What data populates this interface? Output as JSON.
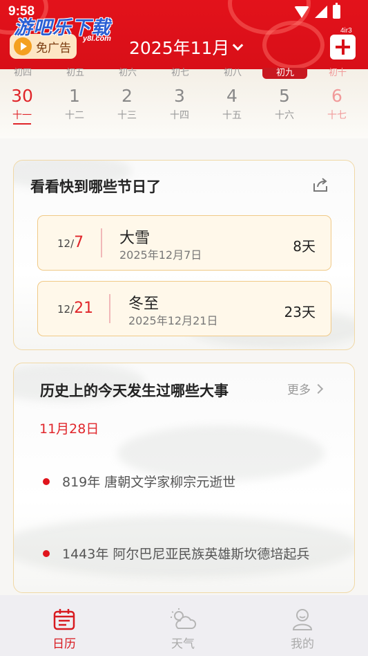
{
  "status_bar": {
    "time": "9:58"
  },
  "watermark": {
    "text": "游吧乐下载",
    "sub": "y8l.com"
  },
  "header": {
    "ad_free_label": "免广告",
    "month_label": "2025年11月",
    "badge_text": "4ir3"
  },
  "week": {
    "partial_labels": [
      "初四",
      "初五",
      "初六",
      "初七",
      "初八",
      "初九",
      "初十"
    ],
    "days": [
      {
        "num": "30",
        "lunar": "十一",
        "state": "today"
      },
      {
        "num": "1",
        "lunar": "十二",
        "state": "normal"
      },
      {
        "num": "2",
        "lunar": "十三",
        "state": "normal"
      },
      {
        "num": "3",
        "lunar": "十四",
        "state": "normal"
      },
      {
        "num": "4",
        "lunar": "十五",
        "state": "normal"
      },
      {
        "num": "5",
        "lunar": "十六",
        "state": "normal"
      },
      {
        "num": "6",
        "lunar": "十七",
        "state": "weekend"
      }
    ]
  },
  "festivals": {
    "title": "看看快到哪些节日了",
    "items": [
      {
        "month": "12/",
        "day": "7",
        "name": "大雪",
        "full_date": "2025年12月7日",
        "days_left": "8天"
      },
      {
        "month": "12/",
        "day": "21",
        "name": "冬至",
        "full_date": "2025年12月21日",
        "days_left": "23天"
      }
    ]
  },
  "history": {
    "title": "历史上的今天发生过哪些大事",
    "more_label": "更多",
    "date": "11月28日",
    "events": [
      "819年 唐朝文学家柳宗元逝世",
      "1443年 阿尔巴尼亚民族英雄斯坎德培起兵"
    ]
  },
  "nav": {
    "items": [
      {
        "label": "日历",
        "icon": "calendar-icon",
        "active": true
      },
      {
        "label": "天气",
        "icon": "weather-icon",
        "active": false
      },
      {
        "label": "我的",
        "icon": "profile-icon",
        "active": false
      }
    ]
  },
  "colors": {
    "brand_red": "#e0252a",
    "header_red": "#d80f18",
    "card_border": "#f0d8a5"
  }
}
